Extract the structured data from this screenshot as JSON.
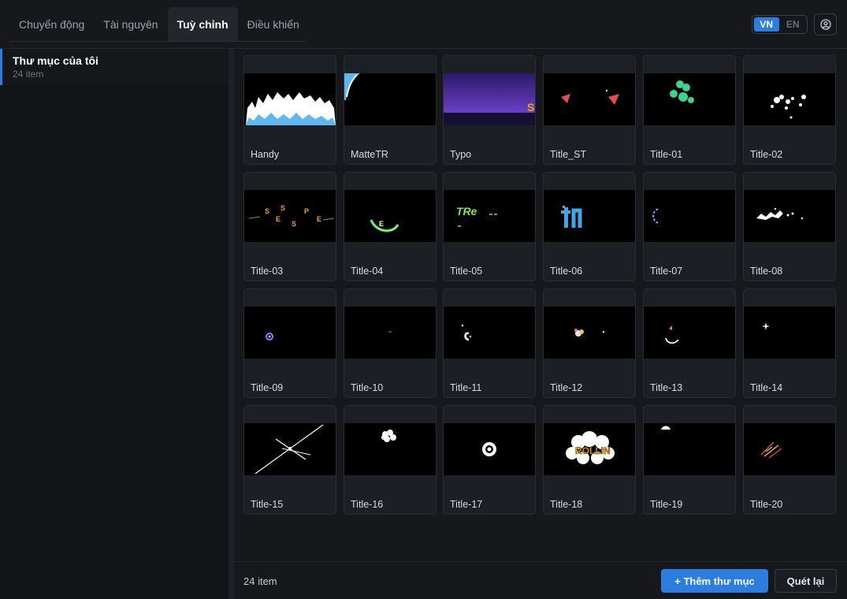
{
  "tabs": [
    {
      "label": "Chuyển động"
    },
    {
      "label": "Tài nguyên"
    },
    {
      "label": "Tuỳ chỉnh"
    },
    {
      "label": "Điều khiển"
    }
  ],
  "lang": {
    "vn": "VN",
    "en": "EN",
    "selected": "VN"
  },
  "account_icon": "user-circle-icon",
  "sidebar": {
    "folders": [
      {
        "name": "Thư mục của tôi",
        "count": "24 item"
      }
    ]
  },
  "items": [
    {
      "name": "Handy"
    },
    {
      "name": "MatteTR"
    },
    {
      "name": "Typo"
    },
    {
      "name": "Title_ST"
    },
    {
      "name": "Title-01"
    },
    {
      "name": "Title-02"
    },
    {
      "name": "Title-03"
    },
    {
      "name": "Title-04"
    },
    {
      "name": "Title-05"
    },
    {
      "name": "Title-06"
    },
    {
      "name": "Title-07"
    },
    {
      "name": "Title-08"
    },
    {
      "name": "Title-09"
    },
    {
      "name": "Title-10"
    },
    {
      "name": "Title-11"
    },
    {
      "name": "Title-12"
    },
    {
      "name": "Title-13"
    },
    {
      "name": "Title-14"
    },
    {
      "name": "Title-15"
    },
    {
      "name": "Title-16"
    },
    {
      "name": "Title-17"
    },
    {
      "name": "Title-18"
    },
    {
      "name": "Title-19"
    },
    {
      "name": "Title-20"
    }
  ],
  "footer": {
    "count": "24 item",
    "add_label": "+ Thêm thư mục",
    "rescan_label": "Quét lại"
  },
  "colors": {
    "accent": "#2b7de0",
    "background": "#16181c"
  }
}
